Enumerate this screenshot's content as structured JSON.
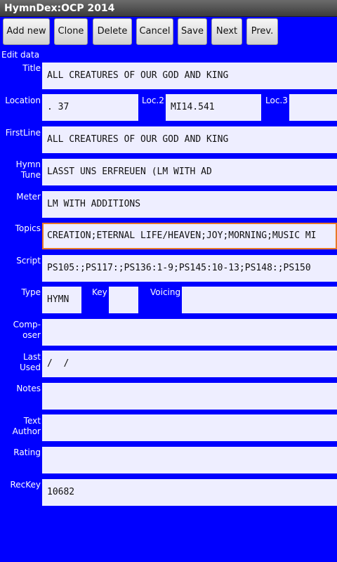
{
  "window": {
    "title": "HymnDex:OCP 2014"
  },
  "toolbar": {
    "add_new": "Add new",
    "clone": "Clone",
    "delete": "Delete",
    "cancel": "Cancel",
    "save": "Save",
    "next": "Next",
    "prev": "Prev."
  },
  "section_label": "Edit data",
  "labels": {
    "title": "Title",
    "location": "Location",
    "loc2": "Loc.2",
    "loc3": "Loc.3",
    "firstline": "FirstLine",
    "hymn_tune_1": "Hymn",
    "hymn_tune_2": "Tune",
    "meter": "Meter",
    "topics": "Topics",
    "script": "Script",
    "type": "Type",
    "key": "Key",
    "voicing": "Voicing",
    "composer_1": "Comp-",
    "composer_2": "oser",
    "last_used_1": "Last",
    "last_used_2": "Used",
    "notes": "Notes",
    "text_author_1": "Text",
    "text_author_2": "Author",
    "rating": "Rating",
    "reckey": "RecKey"
  },
  "values": {
    "title": "ALL CREATURES OF OUR GOD AND KING",
    "location": ". 37",
    "loc2": "MI14.541",
    "loc3": "",
    "firstline": "ALL CREATURES OF OUR GOD AND KING",
    "hymn_tune": "LASST UNS ERFREUEN (LM WITH AD",
    "meter": "LM WITH ADDITIONS",
    "topics": "CREATION;ETERNAL LIFE/HEAVEN;JOY;MORNING;MUSIC MI",
    "script": "PS105:;PS117:;PS136:1-9;PS145:10-13;PS148:;PS150",
    "type": "HYMN",
    "key": "",
    "voicing": "",
    "composer": "",
    "last_used": "/  /",
    "notes": "",
    "text_author": "",
    "rating": "",
    "reckey": "10682"
  }
}
